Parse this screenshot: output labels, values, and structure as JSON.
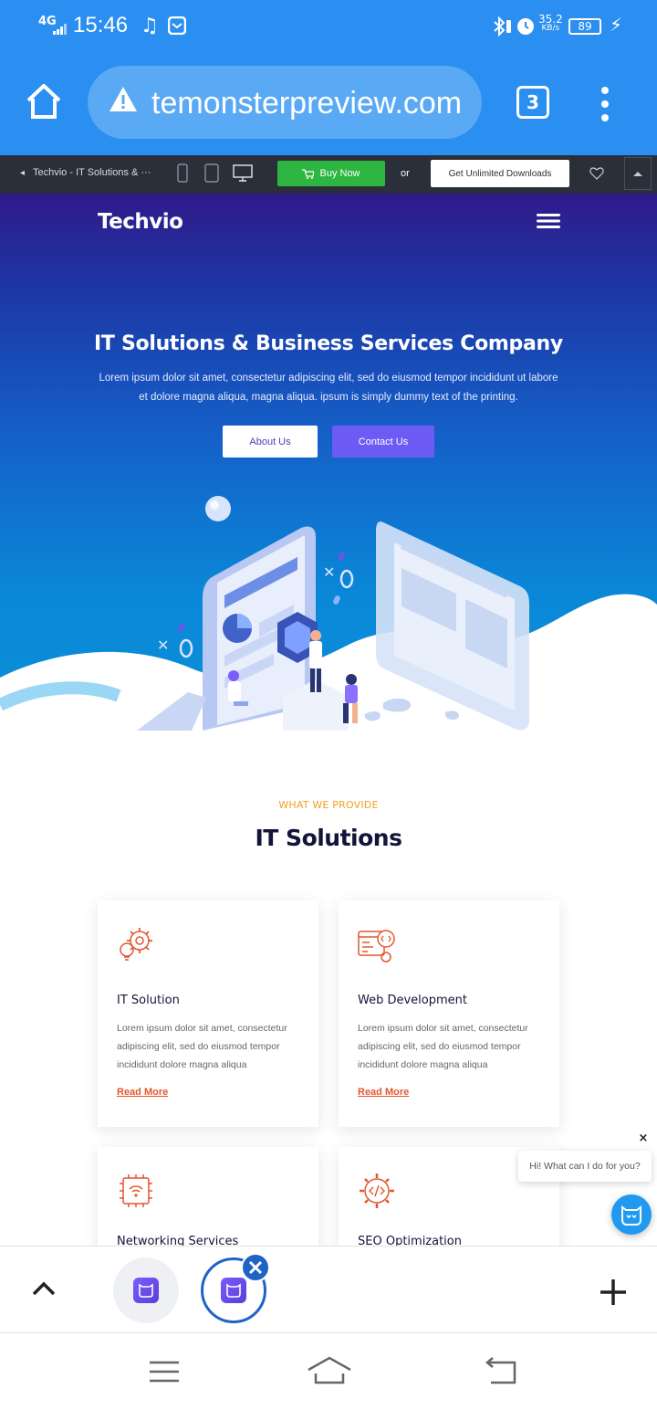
{
  "status": {
    "network": "4G",
    "time": "15:46",
    "speed_top": "35.2",
    "speed_unit": "KB/s",
    "battery": "89"
  },
  "browser": {
    "url": "temonsterpreview.com",
    "tab_count": "3"
  },
  "toolbar": {
    "title": "Techvio - IT Solutions & ···",
    "buy_now": "Buy Now",
    "or": "or",
    "unlimited": "Get Unlimited Downloads"
  },
  "hero": {
    "logo": "Techvio",
    "title": "IT Solutions & Business Services Company",
    "text_line1": "Lorem ipsum dolor sit amet, consectetur adipiscing elit, sed do eiusmod tempor incididunt ut labore",
    "text_line2": "et dolore magna aliqua, magna aliqua. ipsum is simply dummy text of the printing.",
    "about_btn": "About Us",
    "contact_btn": "Contact Us"
  },
  "services": {
    "eyebrow": "WHAT WE PROVIDE",
    "title": "IT Solutions",
    "cards": [
      {
        "title": "IT Solution",
        "text": "Lorem ipsum dolor sit amet, consectetur adipiscing elit, sed do eiusmod tempor incididunt dolore magna aliqua",
        "link": "Read More",
        "icon": "gear-bulb-icon"
      },
      {
        "title": "Web Development",
        "text": "Lorem ipsum dolor sit amet, consectetur adipiscing elit, sed do eiusmod tempor incididunt dolore magna aliqua",
        "link": "Read More",
        "icon": "code-window-icon"
      },
      {
        "title": "Networking Services",
        "icon": "wifi-chip-icon"
      },
      {
        "title": "SEO Optimization",
        "icon": "code-gear-icon"
      }
    ]
  },
  "chat": {
    "close": "×",
    "greeting": "Hi! What can I do for you?"
  },
  "colors": {
    "browser_blue": "#2a8ff0",
    "toolbar_dark": "#2b2f3a",
    "buy_green": "#2db742",
    "accent_purple": "#6c5cf5",
    "eyebrow_orange": "#f0a020",
    "link_orange": "#e4572e"
  }
}
